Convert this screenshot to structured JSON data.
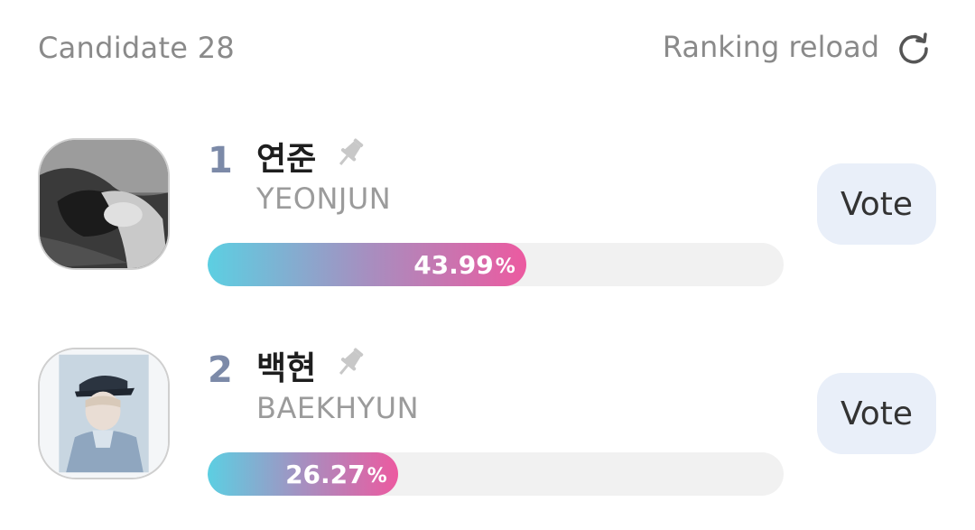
{
  "header": {
    "candidate_count": "Candidate 28",
    "reload_label": "Ranking reload",
    "reload_icon": "refresh-icon"
  },
  "candidates": [
    {
      "rank": "1",
      "name_ko": "연준",
      "name_en": "YEONJUN",
      "percent_value": "43.99",
      "percent_unit": "%",
      "vote_label": "Vote",
      "pin_icon": "pin-icon"
    },
    {
      "rank": "2",
      "name_ko": "백현",
      "name_en": "BAEKHYUN",
      "percent_value": "26.27",
      "percent_unit": "%",
      "vote_label": "Vote",
      "pin_icon": "pin-icon"
    }
  ],
  "colors": {
    "gradient_start": "#5ccfe2",
    "gradient_end": "#ec5aa0",
    "rank_color": "#7c8aa8",
    "vote_button_bg": "#e9eff9"
  }
}
